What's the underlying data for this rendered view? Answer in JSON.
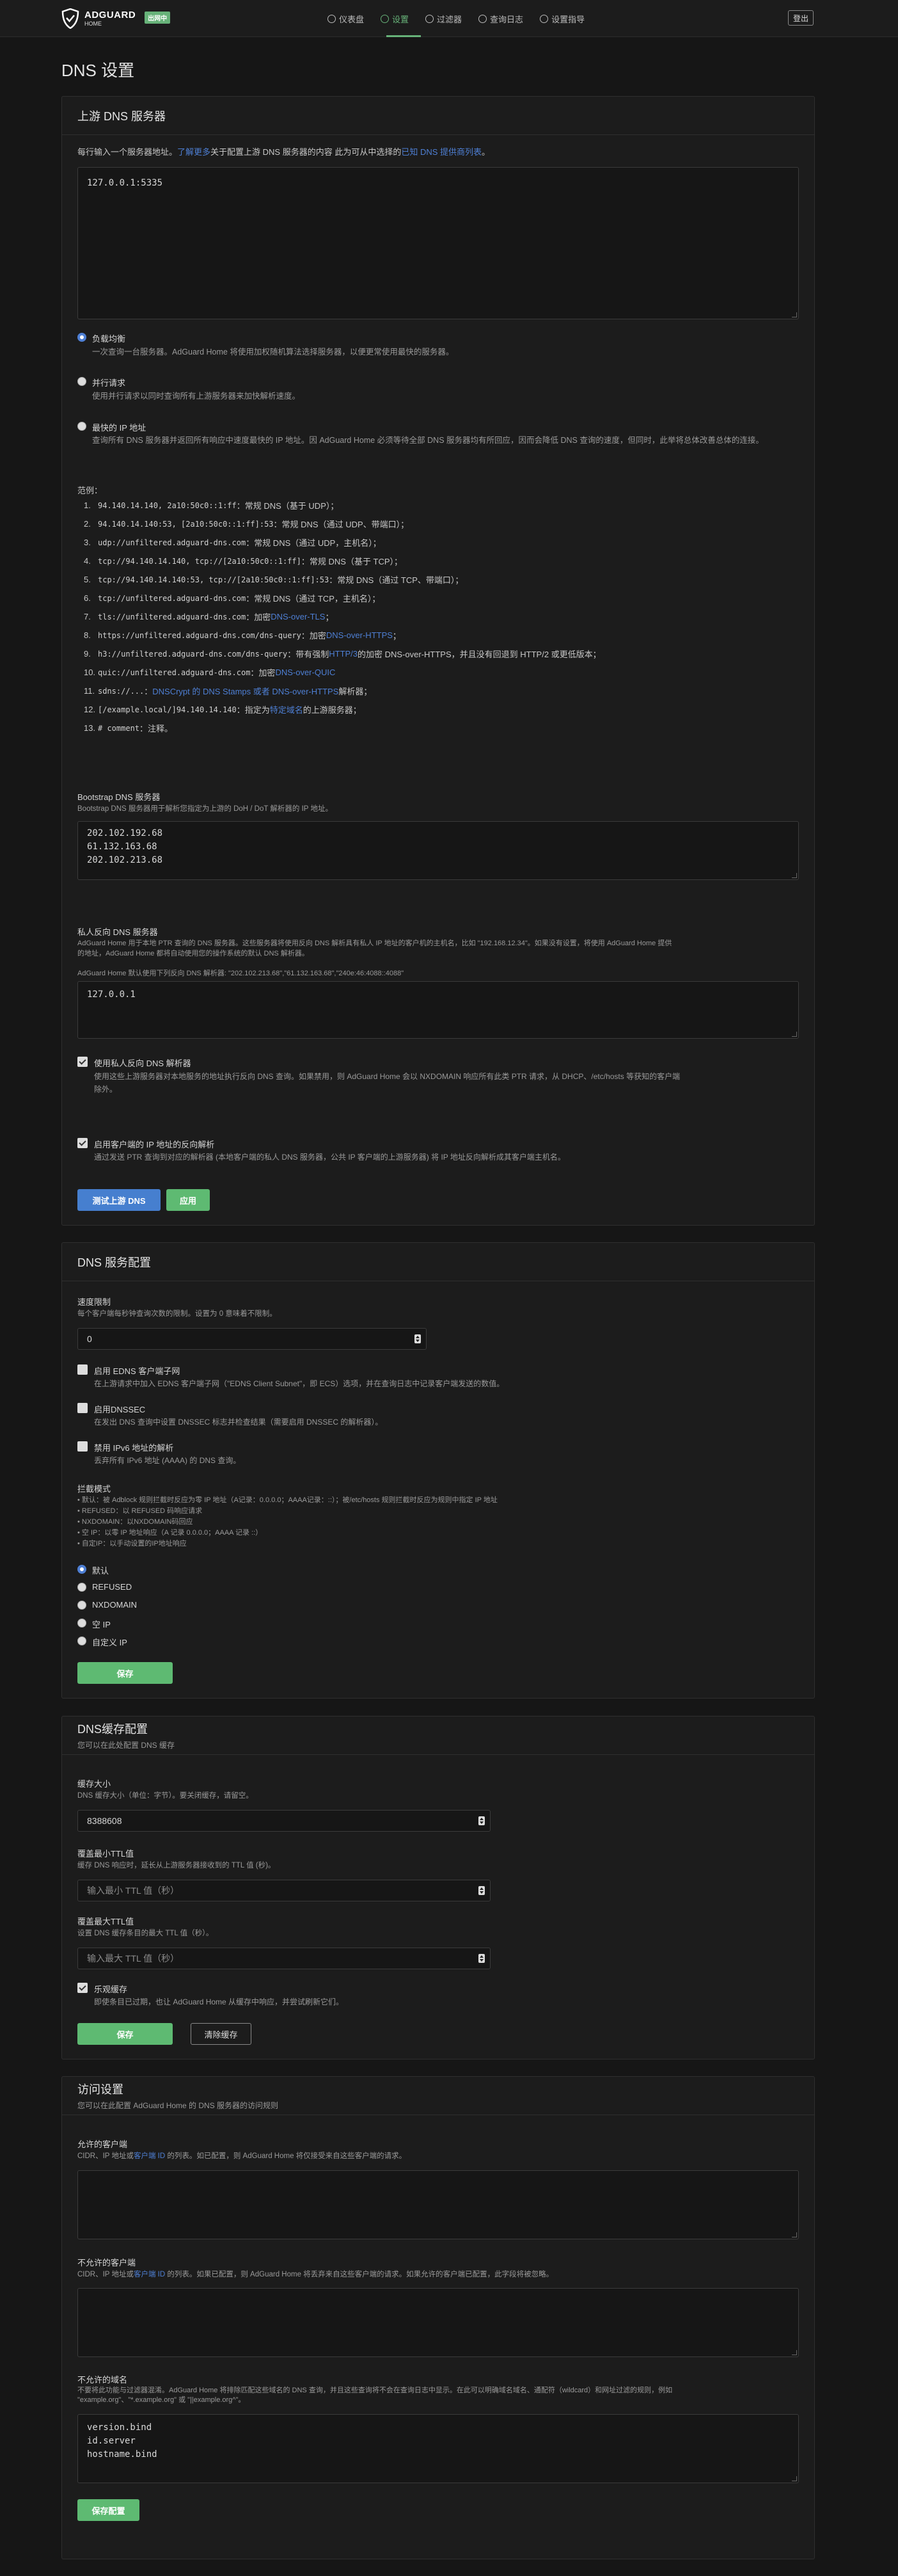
{
  "header": {
    "logo_title": "ADGUARD",
    "logo_sub": "HOME",
    "badge": "出网中",
    "nav": [
      {
        "label": "仪表盘",
        "icon": "dashboard-icon"
      },
      {
        "label": "设置",
        "icon": "settings-icon"
      },
      {
        "label": "过滤器",
        "icon": "filter-icon"
      },
      {
        "label": "查询日志",
        "icon": "log-icon"
      },
      {
        "label": "设置指导",
        "icon": "guide-icon"
      }
    ],
    "logout": "登出"
  },
  "page_title": "DNS 设置",
  "upstream": {
    "title": "上游 DNS 服务器",
    "intro_a": "每行输入一个服务器地址。",
    "intro_link1": "了解更多",
    "intro_b": "关于配置上游 DNS 服务器的内容 此为可从中选择的",
    "intro_link2": "已知 DNS 提供商列表",
    "intro_c": "。",
    "servers_value": "127.0.0.1:5335",
    "modes": [
      {
        "title": "负载均衡",
        "desc": "一次查询一台服务器。AdGuard Home 将使用加权随机算法选择服务器，以便更常使用最快的服务器。"
      },
      {
        "title": "并行请求",
        "desc": "使用并行请求以同时查询所有上游服务器来加快解析速度。"
      },
      {
        "title": "最快的 IP 地址",
        "desc": "查询所有 DNS 服务器并返回所有响应中速度最快的 IP 地址。因 AdGuard Home 必须等待全部 DNS 服务器均有所回应，因而会降低 DNS 查询的速度，但同时，此举将总体改善总体的连接。"
      }
    ],
    "examples_title": "范例：",
    "examples": [
      {
        "code": "94.140.14.140, 2a10:50c0::1:ff",
        "text": "：常规 DNS（基于 UDP）；",
        "link": "",
        "tail": ""
      },
      {
        "code": "94.140.14.140:53, [2a10:50c0::1:ff]:53",
        "text": "：常规 DNS（通过 UDP、带端口）；",
        "link": "",
        "tail": ""
      },
      {
        "code": "udp://unfiltered.adguard-dns.com",
        "text": "：常规 DNS（通过 UDP，主机名）；",
        "link": "",
        "tail": ""
      },
      {
        "code": "tcp://94.140.14.140, tcp://[2a10:50c0::1:ff]",
        "text": "：常规 DNS（基于 TCP）；",
        "link": "",
        "tail": ""
      },
      {
        "code": "tcp://94.140.14.140:53, tcp://[2a10:50c0::1:ff]:53",
        "text": "：常规 DNS（通过 TCP、带端口）；",
        "link": "",
        "tail": ""
      },
      {
        "code": "tcp://unfiltered.adguard-dns.com",
        "text": "：常规 DNS（通过 TCP，主机名）；",
        "link": "",
        "tail": ""
      },
      {
        "code": "tls://unfiltered.adguard-dns.com",
        "text": "：加密 ",
        "link": "DNS-over-TLS",
        "tail": "；"
      },
      {
        "code": "https://unfiltered.adguard-dns.com/dns-query",
        "text": "：加密 ",
        "link": "DNS-over-HTTPS",
        "tail": "；"
      },
      {
        "code": "h3://unfiltered.adguard-dns.com/dns-query",
        "text": "：带有强制 ",
        "link": "HTTP/3",
        "tail": " 的加密 DNS-over-HTTPS，并且没有回退到 HTTP/2 或更低版本；"
      },
      {
        "code": "quic://unfiltered.adguard-dns.com",
        "text": "：加密 ",
        "link": "DNS-over-QUIC",
        "tail": ""
      },
      {
        "code": "sdns://...",
        "text": "：",
        "link": "DNSCrypt 的 DNS Stamps 或者 DNS-over-HTTPS",
        "tail": " 解析器；"
      },
      {
        "code": "[/example.local/]94.140.14.140",
        "text": "：指定为",
        "link": "特定域名",
        "tail": "的上游服务器；"
      },
      {
        "code": "# comment",
        "text": "：注释。",
        "link": "",
        "tail": ""
      }
    ],
    "bootstrap_title": "Bootstrap DNS 服务器",
    "bootstrap_desc": "Bootstrap DNS 服务器用于解析您指定为上游的 DoH / DoT 解析器的 IP 地址。",
    "bootstrap_value": "202.102.192.68\n61.132.163.68\n202.102.213.68",
    "private_title": "私人反向 DNS 服务器",
    "private_desc1": "AdGuard Home 用于本地 PTR 查询的 DNS 服务器。这些服务器将使用反向 DNS 解析具有私人 IP 地址的客户机的主机名，比如 \"192.168.12.34\"。如果没有设置，将使用 AdGuard Home 提供",
    "private_desc2": "的地址，AdGuard Home 都将自动使用您的操作系统的默认 DNS 解析器。",
    "private_default": "AdGuard Home 默认使用下列反向 DNS 解析器: \"202.102.213.68\",\"61.132.163.68\",\"240e:46:4088::4088\"",
    "private_value": "127.0.0.1",
    "use_private_title": "使用私人反向 DNS 解析器",
    "use_private_desc1": "使用这些上游服务器对本地服务的地址执行反向 DNS 查询。如果禁用，则 AdGuard Home 会以 NXDOMAIN 响应所有此类 PTR 请求，从 DHCP、/etc/hosts 等获知的客户端",
    "use_private_desc2": "除外。",
    "resolve_title": "启用客户端的 IP 地址的反向解析",
    "resolve_desc": "通过发送 PTR 查询到对应的解析器 (本地客户端的私人 DNS 服务器，公共 IP 客户端的上游服务器) 将 IP 地址反向解析成其客户端主机名。",
    "test_btn": "测试上游 DNS",
    "apply_btn": "应用"
  },
  "dns_config": {
    "title": "DNS 服务配置",
    "rate_title": "速度限制",
    "rate_desc": "每个客户端每秒钟查询次数的限制。设置为 0 意味着不限制。",
    "rate_value": "0",
    "edns_title": "启用 EDNS 客户端子网",
    "edns_desc": "在上游请求中加入 EDNS 客户端子网（\"EDNS Client Subnet\"，即 ECS）选项，并在查询日志中记录客户端发送的数值。",
    "dnssec_title": "启用DNSSEC",
    "dnssec_desc": "在发出 DNS 查询中设置 DNSSEC 标志并检查结果（需要启用 DNSSEC 的解析器）。",
    "ipv6_title": "禁用 IPv6 地址的解析",
    "ipv6_desc": "丢弃所有 IPv6 地址 (AAAA) 的 DNS 查询。",
    "block_title": "拦截模式",
    "block_bullets": [
      "默认：被 Adblock 规则拦截时反应为零 IP 地址（A记录：0.0.0.0；AAAA记录：::）；被/etc/hosts 规则拦截时反应为规则中指定 IP 地址",
      "REFUSED：以 REFUSED 码响应请求",
      "NXDOMAIN：以NXDOMAIN码回应",
      "空 IP：以零 IP 地址响应（A 记录 0.0.0.0；AAAA 记录 ::）",
      "自定IP：以手动设置的IP地址响应"
    ],
    "block_modes": [
      "默认",
      "REFUSED",
      "NXDOMAIN",
      "空 IP",
      "自定义 IP"
    ],
    "save_btn": "保存"
  },
  "cache": {
    "title": "DNS缓存配置",
    "subtitle": "您可以在此处配置 DNS 缓存",
    "size_title": "缓存大小",
    "size_desc": "DNS 缓存大小（单位：字节）。要关闭缓存，请留空。",
    "size_value": "8388608",
    "min_title": "覆盖最小TTL值",
    "min_desc": "缓存 DNS 响应时，延长从上游服务器接收到的 TTL 值 (秒)。",
    "min_placeholder": "输入最小 TTL 值（秒）",
    "max_title": "覆盖最大TTL值",
    "max_desc": "设置 DNS 缓存条目的最大 TTL 值（秒）。",
    "max_placeholder": "输入最大 TTL 值（秒）",
    "optimistic_title": "乐观缓存",
    "optimistic_desc": "即使条目已过期，也让 AdGuard Home 从缓存中响应，并尝试刷新它们。",
    "save_btn": "保存",
    "clear_btn": "清除缓存"
  },
  "access": {
    "title": "访问设置",
    "subtitle": "您可以在此配置 AdGuard Home 的 DNS 服务器的访问规则",
    "allowed_title": "允许的客户端",
    "allowed_desc_a": "CIDR、IP 地址或",
    "allowed_desc_link": "客户端 ID",
    "allowed_desc_b": " 的列表。如已配置，则 AdGuard Home 将仅接受来自这些客户端的请求。",
    "disallowed_title": "不允许的客户端",
    "disallowed_desc_a": "CIDR、IP 地址或",
    "disallowed_desc_link": "客户端 ID",
    "disallowed_desc_b": " 的列表。如果已配置，则 AdGuard Home 将丢弃来自这些客户端的请求。如果允许的客户端已配置，此字段将被忽略。",
    "domains_title": "不允许的域名",
    "domains_desc1": "不要将此功能与过滤器混淆。AdGuard Home 将排除匹配这些域名的 DNS 查询，并且这些查询将不会在查询日志中显示。在此可以明确域名域名、通配符（wildcard）和网址过滤的规则，例如",
    "domains_desc2": "\"example.org\"、\"*.example.org\" 或 \"||example.org^\"。",
    "domains_value": "version.bind\nid.server\nhostname.bind",
    "save_btn": "保存配置"
  },
  "colors": {
    "accent_green": "#5eba72",
    "accent_blue": "#467fcf",
    "link": "#4e7fd4"
  }
}
